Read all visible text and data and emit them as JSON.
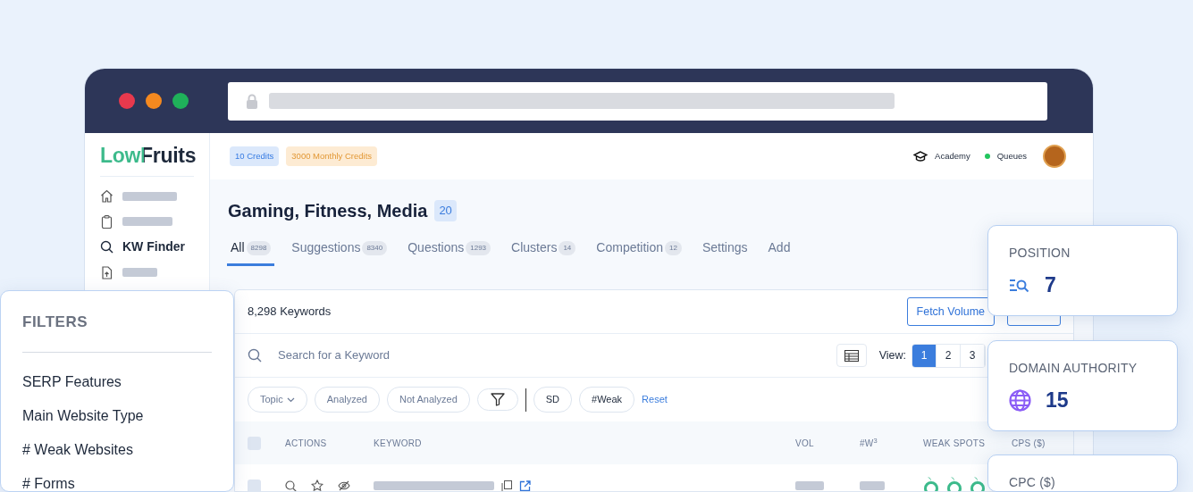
{
  "sidebar": {
    "logo": "LowFruits",
    "items": [
      {
        "kind": "skeleton",
        "selected": false
      },
      {
        "kind": "skeleton",
        "selected": false
      },
      {
        "kind": "link",
        "label": "KW Finder",
        "selected": true
      },
      {
        "kind": "skeleton",
        "selected": false
      }
    ]
  },
  "topbar": {
    "credits": [
      {
        "label": "10 Credits",
        "color": "#dbe8fb"
      },
      {
        "label": "3000 Monthly Credits",
        "color": "#fdebd3"
      }
    ],
    "links": [
      {
        "kind": "academy",
        "label": "Academy"
      },
      {
        "kind": "status",
        "label": "Queues",
        "color": "#22c55e"
      }
    ]
  },
  "project": {
    "title": "Gaming, Fitness, Media",
    "count": "20"
  },
  "tabs": [
    {
      "label": "All",
      "count": "8298",
      "selected": true
    },
    {
      "label": "Suggestions",
      "count": "8340",
      "selected": false
    },
    {
      "label": "Questions",
      "count": "1293",
      "selected": false
    },
    {
      "label": "Clusters",
      "count": "14",
      "selected": false
    },
    {
      "label": "Competition",
      "count": "12",
      "selected": false
    },
    {
      "label": "Settings",
      "selected": false
    },
    {
      "label": "Add",
      "selected": false
    }
  ],
  "keywords_panel": {
    "total": "8,298 Keywords",
    "button": "Fetch Volume"
  },
  "search": {
    "placeholder": "Search for a Keyword"
  },
  "view": {
    "label": "View:",
    "options": [
      {
        "label": "1",
        "selected": true
      },
      {
        "label": "2",
        "selected": false
      },
      {
        "label": "3",
        "selected": false
      }
    ]
  },
  "chips": [
    {
      "kind": "dropdown",
      "label": "Topic"
    },
    {
      "kind": "chip",
      "label": "Analyzed"
    },
    {
      "kind": "chip",
      "label": "Not Analyzed"
    },
    {
      "kind": "icon"
    },
    {
      "kind": "divider"
    },
    {
      "kind": "chip",
      "label": "SD"
    },
    {
      "kind": "chip",
      "label": "#Weak"
    },
    {
      "kind": "link",
      "label": "Reset"
    }
  ],
  "table": {
    "header_checked": false,
    "columns": [
      "ACTIONS",
      "KEYWORD",
      "VOL",
      "#W$^{3}$",
      "WEAK SPOTS",
      "CPS ($)"
    ],
    "rows": [
      {
        "checked": false
      }
    ]
  },
  "filters": {
    "title": "FILTERS",
    "items": [
      "SERP Features",
      "Main Website Type",
      "# Weak Websites",
      "# Forms"
    ]
  },
  "metrics": [
    {
      "kind": "position",
      "label": "POSITION",
      "value": "7"
    },
    {
      "kind": "domain_authority",
      "label": "DOMAIN AUTHORITY",
      "value": "15"
    },
    {
      "kind": "cpc",
      "label": "CPC ($)"
    }
  ]
}
